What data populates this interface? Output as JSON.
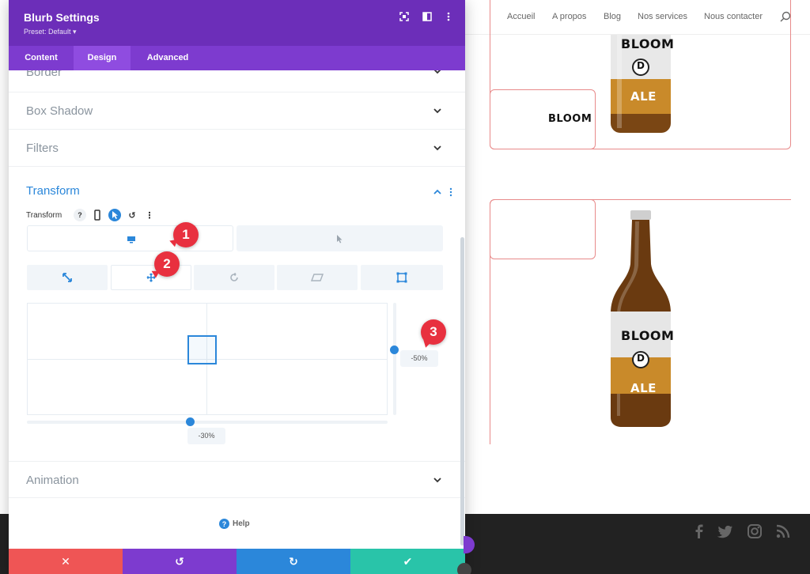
{
  "site": {
    "nav": [
      "Accueil",
      "A propos",
      "Blog",
      "Nos services",
      "Nous contacter"
    ],
    "cards": [
      {
        "label": "BLOOM"
      }
    ],
    "bottle_text": {
      "brand": "BLOOM",
      "mark": "D",
      "type": "ALE"
    }
  },
  "panel": {
    "title": "Blurb Settings",
    "preset": "Preset: Default ▾",
    "tabs": [
      "Content",
      "Design",
      "Advanced"
    ],
    "active_tab": "Design",
    "sections": {
      "border": "Border",
      "box_shadow": "Box Shadow",
      "filters": "Filters",
      "transform": "Transform",
      "animation": "Animation"
    },
    "transform_label": "Transform",
    "transform_controls": {
      "help": "?",
      "undo": "↺",
      "more": "⋮"
    },
    "translate": {
      "x_value": "-30%",
      "y_value": "-50%"
    },
    "help_label": "Help",
    "help_icon": "?"
  },
  "markers": [
    "1",
    "2",
    "3"
  ],
  "colors": {
    "header_purple": "#6c2eb9",
    "tab_purple": "#7d3bcf",
    "accent_blue": "#2b87da",
    "cancel_red": "#ef5555",
    "undo_purple": "#7d3bcf",
    "redo_blue": "#2b87da",
    "save_green": "#29c4a9",
    "marker_red": "#e8303f"
  },
  "footer_buttons": {
    "cancel": "✕",
    "undo": "↺",
    "redo": "↻",
    "save": "✔"
  }
}
